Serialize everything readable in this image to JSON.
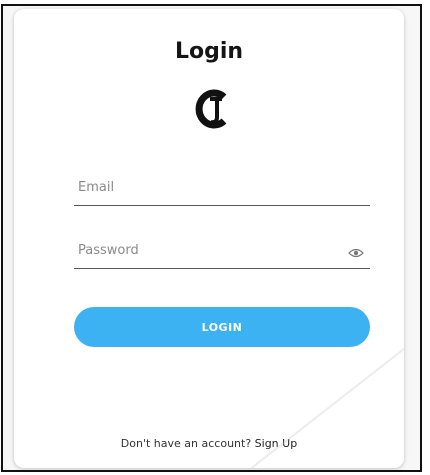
{
  "login": {
    "title": "Login",
    "logo_text": "CJ",
    "email": {
      "placeholder": "Email",
      "value": ""
    },
    "password": {
      "placeholder": "Password",
      "value": ""
    },
    "eye_icon": "eye-icon",
    "login_button_label": "LOGIN",
    "footer_prompt": "Don't have an account? ",
    "signup_link": "Sign Up"
  },
  "colors": {
    "accent": "#3db2f2",
    "title": "#151515",
    "border": "#111111"
  }
}
